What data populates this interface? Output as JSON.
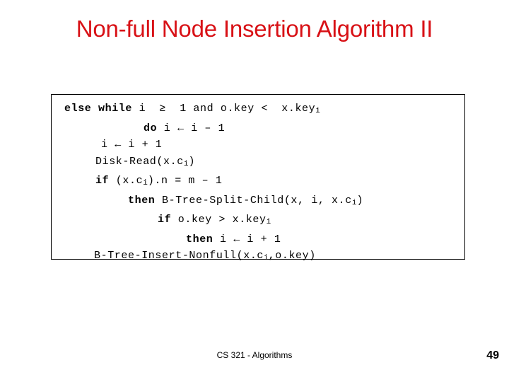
{
  "slide": {
    "title": "Non-full Node Insertion Algorithm II",
    "title_color": "#d81116",
    "footer": "CS 321 - Algorithms",
    "page_number": "49"
  },
  "code": {
    "lines": [
      {
        "indent": 0,
        "parts": [
          {
            "text": "else while",
            "bold": true
          },
          {
            "text": " i  ≥  1 and o.key <  x.key",
            "bold": false
          },
          {
            "text": "i",
            "bold": false,
            "sub": true
          }
        ]
      },
      {
        "indent": 1,
        "parts": [
          {
            "text": "do",
            "bold": true
          },
          {
            "text": " i ← i – 1",
            "bold": false
          }
        ]
      },
      {
        "indent": 2,
        "parts": [
          {
            "text": "i ← i + 1",
            "bold": false
          }
        ]
      },
      {
        "indent": 3,
        "parts": [
          {
            "text": "Disk-Read(x.c",
            "bold": false
          },
          {
            "text": "i",
            "bold": false,
            "sub": true
          },
          {
            "text": ")",
            "bold": false
          }
        ]
      },
      {
        "indent": 4,
        "parts": [
          {
            "text": "if",
            "bold": true
          },
          {
            "text": " (x.c",
            "bold": false
          },
          {
            "text": "i",
            "bold": false,
            "sub": true
          },
          {
            "text": ").n = m – 1",
            "bold": false
          }
        ]
      },
      {
        "indent": 5,
        "parts": [
          {
            "text": "then",
            "bold": true
          },
          {
            "text": " B-Tree-Split-Child(x, i, x.c",
            "bold": false
          },
          {
            "text": "i",
            "bold": false,
            "sub": true
          },
          {
            "text": ")",
            "bold": false
          }
        ]
      },
      {
        "indent": 6,
        "parts": [
          {
            "text": "if",
            "bold": true
          },
          {
            "text": " o.key > x.key",
            "bold": false
          },
          {
            "text": "i",
            "bold": false,
            "sub": true
          }
        ]
      },
      {
        "indent": 7,
        "parts": [
          {
            "text": "then",
            "bold": true
          },
          {
            "text": " i ← i + 1",
            "bold": false
          }
        ]
      },
      {
        "indent": 8,
        "parts": [
          {
            "text": "B-Tree-Insert-Nonfull(x.c",
            "bold": false
          },
          {
            "text": "i",
            "bold": false,
            "sub": true
          },
          {
            "text": ",o.key)",
            "bold": false
          }
        ]
      }
    ]
  }
}
